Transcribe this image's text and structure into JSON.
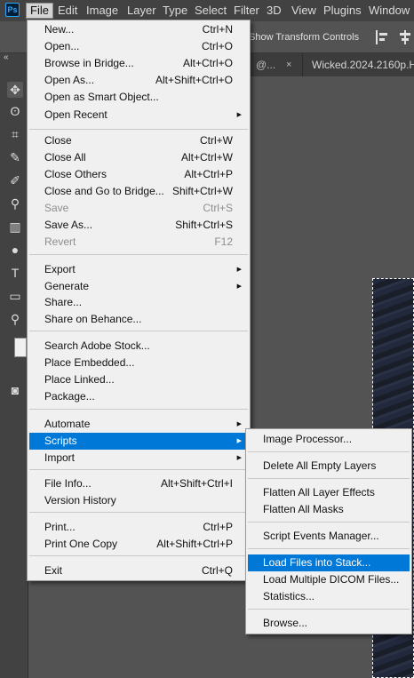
{
  "menubar": {
    "logo": "Ps",
    "items": [
      "File",
      "Edit",
      "Image",
      "Layer",
      "Type",
      "Select",
      "Filter",
      "3D",
      "View",
      "Plugins",
      "Window"
    ]
  },
  "options_bar": {
    "show_transform_controls": "Show Transform Controls"
  },
  "panel_strip": {
    "collapse": "«"
  },
  "document_tabs": [
    {
      "label": "@...",
      "close": "×"
    },
    {
      "label": "Wicked.2024.2160p.H"
    }
  ],
  "tools": [
    {
      "name": "move-tool-icon",
      "glyph": "✥"
    },
    {
      "name": "lasso-tool-icon",
      "glyph": "ʘ"
    },
    {
      "name": "crop-tool-icon",
      "glyph": "⌗"
    },
    {
      "name": "eyedropper-tool-icon",
      "glyph": "✎"
    },
    {
      "name": "brush-tool-icon",
      "glyph": "✐"
    },
    {
      "name": "stamp-tool-icon",
      "glyph": "⚲"
    },
    {
      "name": "gradient-tool-icon",
      "glyph": "▥"
    },
    {
      "name": "burn-tool-icon",
      "glyph": "●"
    },
    {
      "name": "type-tool-icon",
      "glyph": "T"
    },
    {
      "name": "rectangle-tool-icon",
      "glyph": "▭"
    },
    {
      "name": "zoom-tool-icon",
      "glyph": "⚲"
    },
    {
      "name": "quick-mask-icon",
      "glyph": "◙"
    }
  ],
  "file_menu": {
    "items": [
      {
        "label": "New...",
        "shortcut": "Ctrl+N"
      },
      {
        "label": "Open...",
        "shortcut": "Ctrl+O"
      },
      {
        "label": "Browse in Bridge...",
        "shortcut": "Alt+Ctrl+O"
      },
      {
        "label": "Open As...",
        "shortcut": "Alt+Shift+Ctrl+O"
      },
      {
        "label": "Open as Smart Object..."
      },
      {
        "label": "Open Recent",
        "submenu": true
      },
      {
        "label": "Close",
        "shortcut": "Ctrl+W"
      },
      {
        "label": "Close All",
        "shortcut": "Alt+Ctrl+W"
      },
      {
        "label": "Close Others",
        "shortcut": "Alt+Ctrl+P"
      },
      {
        "label": "Close and Go to Bridge...",
        "shortcut": "Shift+Ctrl+W"
      },
      {
        "label": "Save",
        "shortcut": "Ctrl+S",
        "disabled": true
      },
      {
        "label": "Save As...",
        "shortcut": "Shift+Ctrl+S"
      },
      {
        "label": "Revert",
        "shortcut": "F12",
        "disabled": true
      },
      {
        "label": "Export",
        "submenu": true
      },
      {
        "label": "Generate",
        "submenu": true
      },
      {
        "label": "Share..."
      },
      {
        "label": "Share on Behance..."
      },
      {
        "label": "Search Adobe Stock..."
      },
      {
        "label": "Place Embedded..."
      },
      {
        "label": "Place Linked..."
      },
      {
        "label": "Package..."
      },
      {
        "label": "Automate",
        "submenu": true
      },
      {
        "label": "Scripts",
        "submenu": true,
        "highlighted": true
      },
      {
        "label": "Import",
        "submenu": true
      },
      {
        "label": "File Info...",
        "shortcut": "Alt+Shift+Ctrl+I"
      },
      {
        "label": "Version History"
      },
      {
        "label": "Print...",
        "shortcut": "Ctrl+P"
      },
      {
        "label": "Print One Copy",
        "shortcut": "Alt+Shift+Ctrl+P"
      },
      {
        "label": "Exit",
        "shortcut": "Ctrl+Q"
      }
    ]
  },
  "scripts_menu": {
    "items": [
      {
        "label": "Image Processor..."
      },
      {
        "label": "Delete All Empty Layers"
      },
      {
        "label": "Flatten All Layer Effects"
      },
      {
        "label": "Flatten All Masks"
      },
      {
        "label": "Script Events Manager..."
      },
      {
        "label": "Load Files into Stack...",
        "highlighted": true
      },
      {
        "label": "Load Multiple DICOM Files..."
      },
      {
        "label": "Statistics..."
      },
      {
        "label": "Browse..."
      }
    ]
  },
  "colors": {
    "highlight": "#0078d7",
    "menu_bg": "#f0f0f0",
    "chrome": "#424242",
    "canvas": "#535353"
  }
}
